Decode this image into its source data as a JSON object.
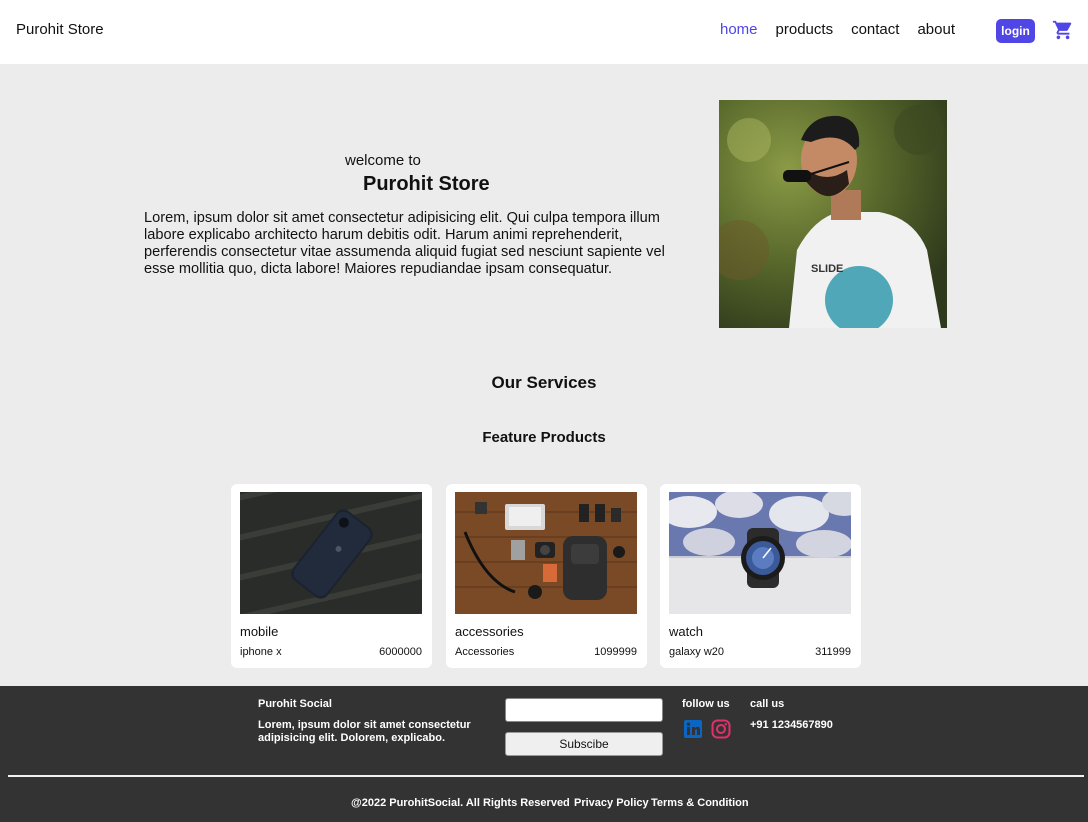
{
  "nav": {
    "brand": "Purohit Store",
    "links": [
      {
        "label": "home",
        "active": true
      },
      {
        "label": "products",
        "active": false
      },
      {
        "label": "contact",
        "active": false
      },
      {
        "label": "about",
        "active": false
      }
    ],
    "login_label": "login",
    "cart_icon": "shopping-cart-icon"
  },
  "hero": {
    "welcome": "welcome to",
    "title": "Purohit Store",
    "text": "Lorem, ipsum dolor sit amet consectetur adipisicing elit. Qui culpa tempora illum labore explicabo architecto harum debitis odit. Harum animi reprehenderit, perferendis consectetur vitae assumenda aliquid fugiat sed nesciunt sapiente vel esse mollitia quo, dicta labore! Maiores repudiandae ipsam consequatur.",
    "image": "man-in-sunglasses-photo"
  },
  "services": {
    "heading": "Our Services",
    "subheading": "Feature Products"
  },
  "products": [
    {
      "category": "mobile",
      "name": "iphone x",
      "price": "6000000",
      "image": "iphone-photo"
    },
    {
      "category": "accessories",
      "name": "Accessories",
      "price": "1099999",
      "image": "accessories-flatlay-photo"
    },
    {
      "category": "watch",
      "name": "galaxy w20",
      "price": "311999",
      "image": "smartwatch-photo"
    }
  ],
  "footer": {
    "title": "Purohit Social",
    "description": "Lorem, ipsum dolor sit amet consectetur adipisicing elit. Dolorem, explicabo.",
    "email_value": "",
    "subscribe_label": "Subscibe",
    "follow_label": "follow us",
    "call_label": "call us",
    "phone": "+91 1234567890",
    "copyright": "@2022 PurohitSocial. All Rights Reserved",
    "privacy": "Privacy Policy",
    "terms": "Terms & Condition"
  },
  "colors": {
    "accent": "#4f46e5",
    "page_bg": "#ececec",
    "footer_bg": "#333333",
    "linkedin": "#0a66c2",
    "instagram": "#e1306c"
  }
}
